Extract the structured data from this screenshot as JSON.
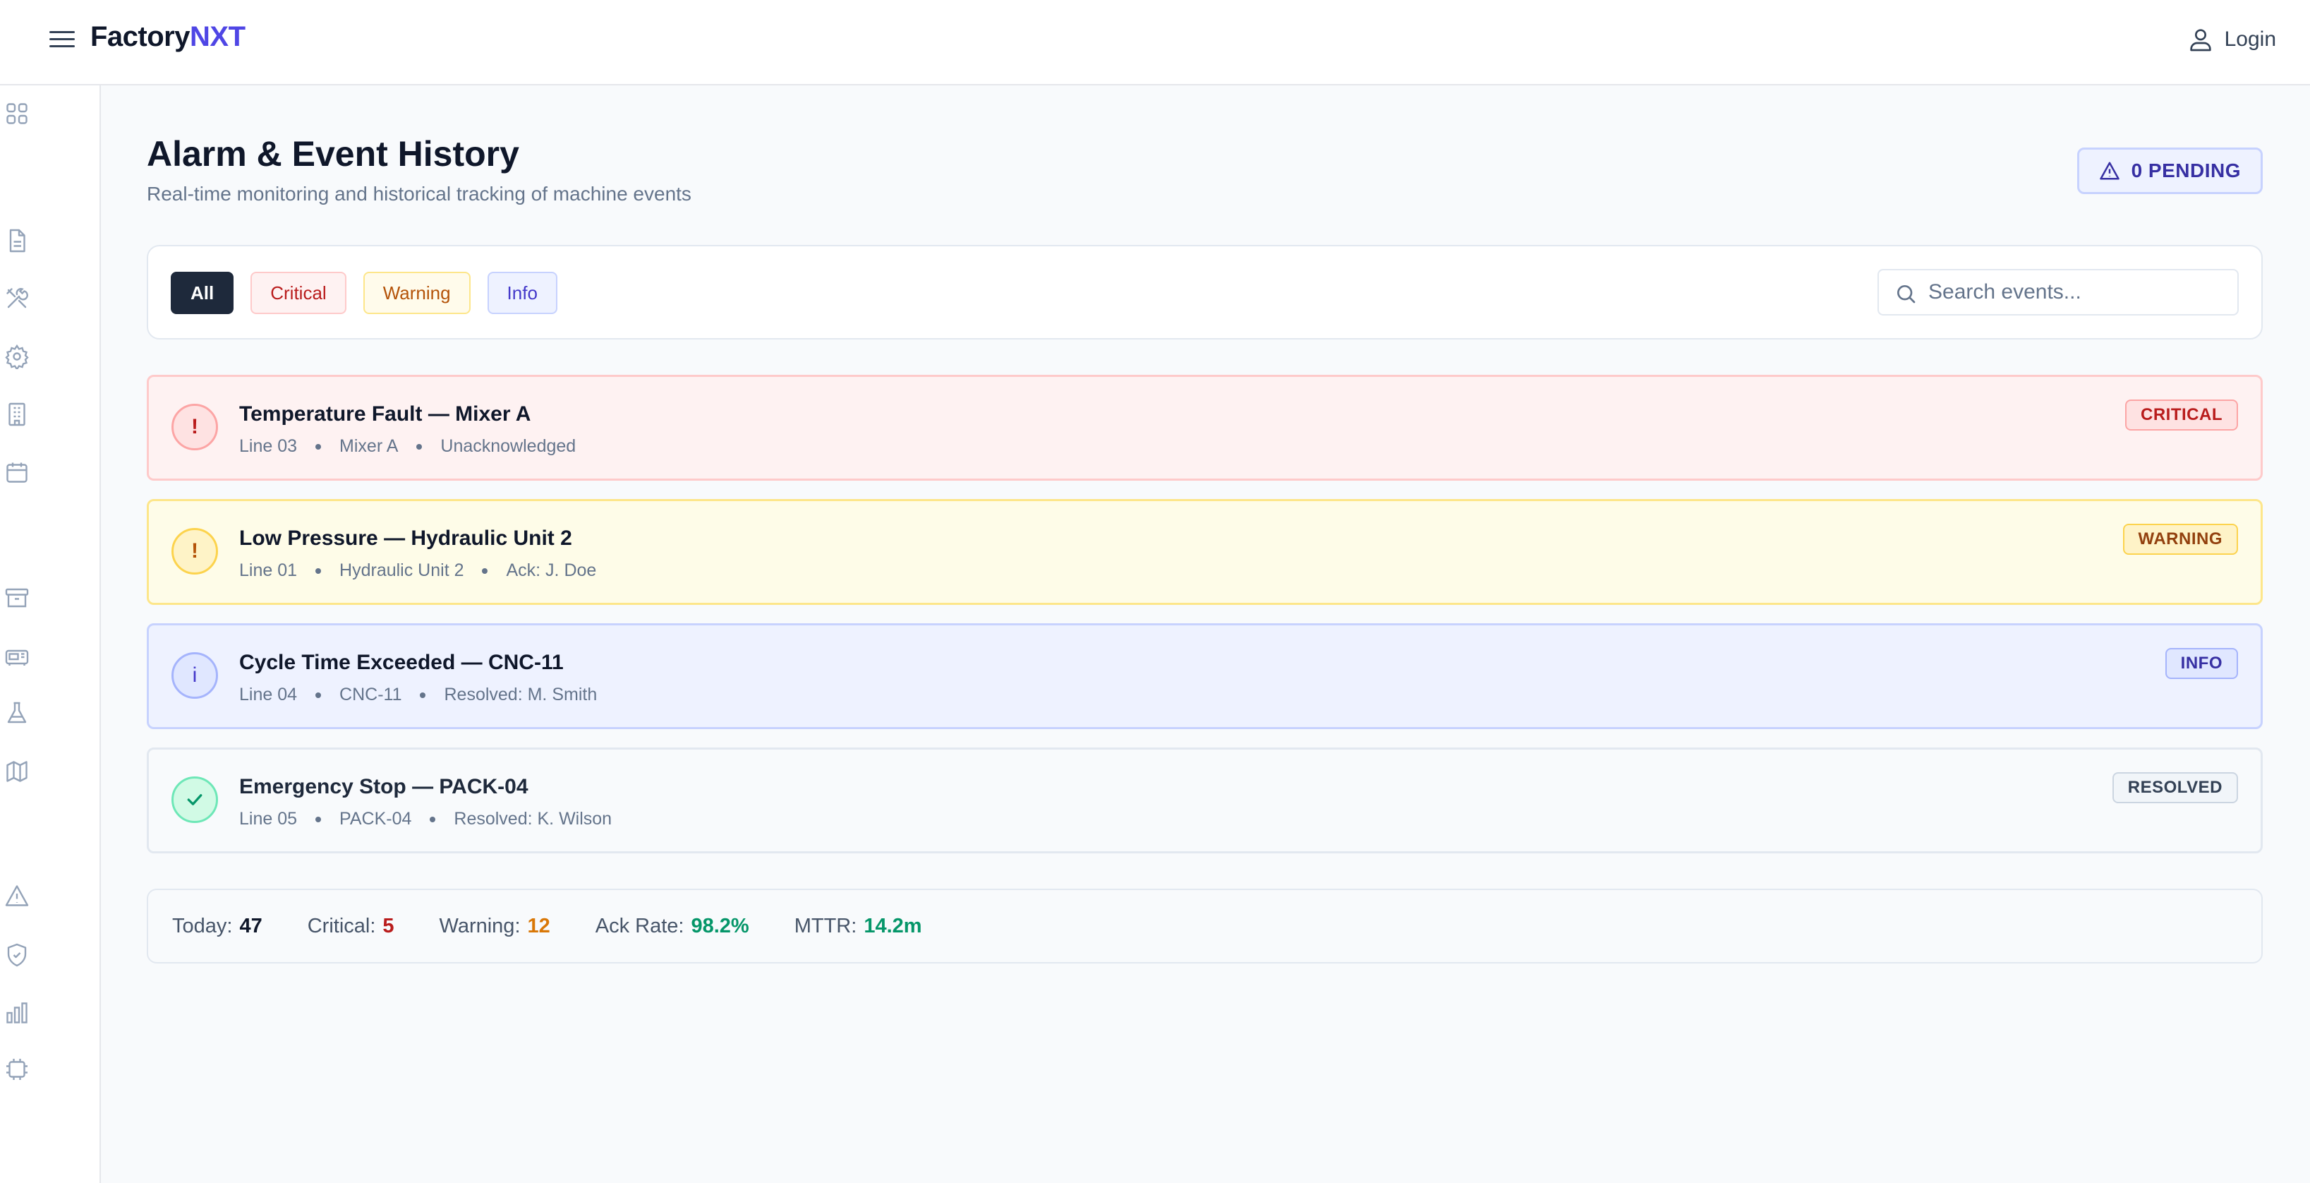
{
  "app": {
    "brand_part1": "Factory",
    "brand_part2": "NXT",
    "login_label": "Login"
  },
  "sidebar": {
    "icons": [
      "grid-icon",
      "document-icon",
      "tools-icon",
      "gear-icon",
      "building-icon",
      "calendar-icon",
      "archive-icon",
      "machine-icon",
      "flask-icon",
      "map-icon",
      "alert-icon",
      "shield-icon",
      "bar-chart-icon",
      "chip-icon"
    ]
  },
  "header": {
    "title": "Alarm & Event History",
    "subtitle": "Real-time monitoring and historical tracking of machine events",
    "pending_label": "0 PENDING"
  },
  "filters": {
    "chips": [
      "All",
      "Critical",
      "Warning",
      "Info"
    ],
    "active": "All",
    "search_placeholder": "Search events...",
    "search_value": ""
  },
  "events": [
    {
      "icon": "!",
      "title": "Temperature Fault — Mixer A",
      "line": "Line 03",
      "machine": "Mixer A",
      "status": "Unacknowledged",
      "badge": "CRITICAL"
    },
    {
      "icon": "!",
      "title": "Low Pressure — Hydraulic Unit 2",
      "line": "Line 01",
      "machine": "Hydraulic Unit 2",
      "status": "Ack: J. Doe",
      "badge": "WARNING"
    },
    {
      "icon": "i",
      "title": "Cycle Time Exceeded — CNC-11",
      "line": "Line 04",
      "machine": "CNC-11",
      "status": "Resolved: M. Smith",
      "badge": "INFO"
    },
    {
      "icon": "check-icon",
      "title": "Emergency Stop — PACK-04",
      "line": "Line 05",
      "machine": "PACK-04",
      "status": "Resolved: K. Wilson",
      "badge": "RESOLVED"
    }
  ],
  "stats": {
    "today_label": "Today:",
    "today_value": "47",
    "critical_label": "Critical:",
    "critical_value": "5",
    "warning_label": "Warning:",
    "warning_value": "12",
    "ack_label": "Ack Rate:",
    "ack_value": "98.2%",
    "mttr_label": "MTTR:",
    "mttr_value": "14.2m"
  },
  "colors": {
    "brand_accent": "#4f46e5",
    "critical": "#b91c1c",
    "warning": "#b45309",
    "info": "#3730a3",
    "success": "#059669"
  }
}
